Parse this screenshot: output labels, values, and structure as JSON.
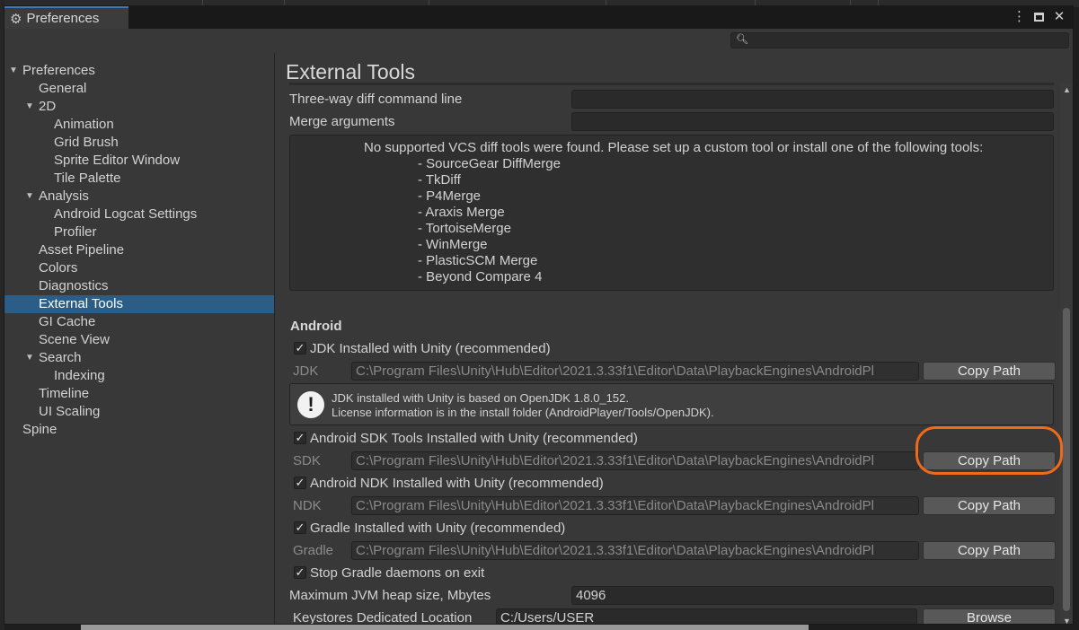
{
  "window": {
    "title": "Preferences"
  },
  "icons": {
    "settings": "gear-icon",
    "menu": "kebab-menu-icon",
    "maximize": "maximize-icon",
    "close": "close-icon",
    "search": "search-icon",
    "warning": "exclamation-icon",
    "check": "checkmark-icon"
  },
  "search": {
    "placeholder": ""
  },
  "sidebar": {
    "items": [
      {
        "label": "Preferences"
      },
      {
        "label": "General"
      },
      {
        "label": "2D"
      },
      {
        "label": "Animation"
      },
      {
        "label": "Grid Brush"
      },
      {
        "label": "Sprite Editor Window"
      },
      {
        "label": "Tile Palette"
      },
      {
        "label": "Analysis"
      },
      {
        "label": "Android Logcat Settings"
      },
      {
        "label": "Profiler"
      },
      {
        "label": "Asset Pipeline"
      },
      {
        "label": "Colors"
      },
      {
        "label": "Diagnostics"
      },
      {
        "label": "External Tools"
      },
      {
        "label": "GI Cache"
      },
      {
        "label": "Scene View"
      },
      {
        "label": "Search"
      },
      {
        "label": "Indexing"
      },
      {
        "label": "Timeline"
      },
      {
        "label": "UI Scaling"
      },
      {
        "label": "Spine"
      }
    ],
    "selected": "External Tools"
  },
  "content": {
    "title": "External Tools",
    "threeway_label": "Three-way diff command line",
    "threeway_value": "",
    "merge_label": "Merge arguments",
    "merge_value": "",
    "vcs_message": "No supported VCS diff tools were found. Please set up a custom tool or install one of the following tools:",
    "vcs_tools": [
      "- SourceGear DiffMerge",
      "- TkDiff",
      "- P4Merge",
      "- Araxis Merge",
      "- TortoiseMerge",
      "- WinMerge",
      "- PlasticSCM Merge",
      "- Beyond Compare 4"
    ],
    "android": {
      "heading": "Android",
      "jdk_check": "JDK Installed with Unity (recommended)",
      "jdk_label": "JDK",
      "jdk_path": "C:\\Program Files\\Unity\\Hub\\Editor\\2021.3.33f1\\Editor\\Data\\PlaybackEngines\\AndroidPl",
      "help_line1": "JDK installed with Unity is based on OpenJDK 1.8.0_152.",
      "help_line2": "License information is in the install folder (AndroidPlayer/Tools/OpenJDK).",
      "sdk_check": "Android SDK Tools Installed with Unity (recommended)",
      "sdk_label": "SDK",
      "sdk_path": "C:\\Program Files\\Unity\\Hub\\Editor\\2021.3.33f1\\Editor\\Data\\PlaybackEngines\\AndroidPl",
      "ndk_check": "Android NDK Installed with Unity (recommended)",
      "ndk_label": "NDK",
      "ndk_path": "C:\\Program Files\\Unity\\Hub\\Editor\\2021.3.33f1\\Editor\\Data\\PlaybackEngines\\AndroidPl",
      "gradle_check": "Gradle Installed with Unity (recommended)",
      "gradle_label": "Gradle",
      "gradle_path": "C:\\Program Files\\Unity\\Hub\\Editor\\2021.3.33f1\\Editor\\Data\\PlaybackEngines\\AndroidPl",
      "stop_gradle_check": "Stop Gradle daemons on exit",
      "jvm_label": "Maximum JVM heap size, Mbytes",
      "jvm_value": "4096",
      "keystore_label": "Keystores Dedicated Location",
      "keystore_value": "C:/Users/USER",
      "copy_path": "Copy Path",
      "browse": "Browse",
      "check_mark": "✓"
    }
  },
  "annotation": {
    "highlight_color": "#f06a1a"
  },
  "colors": {
    "accent": "#3a79bb",
    "selection": "#2c5d87",
    "background": "#383838"
  }
}
